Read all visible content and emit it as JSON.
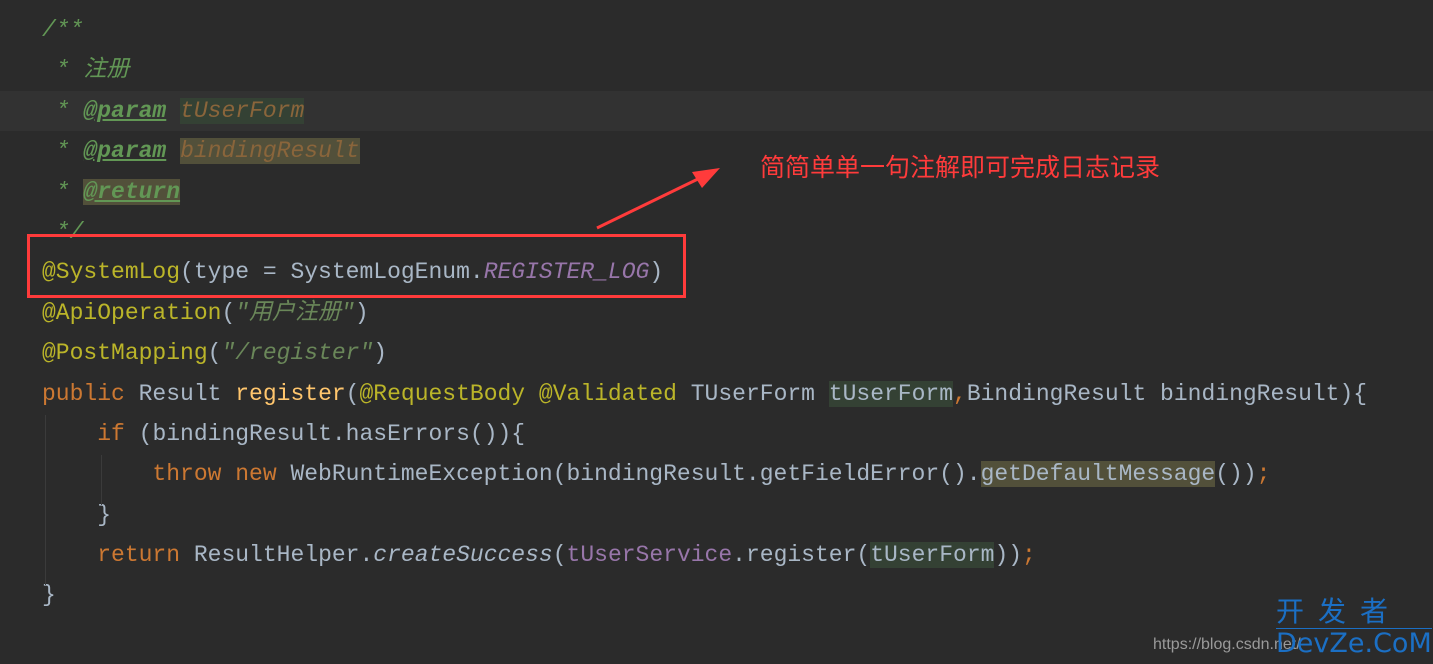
{
  "editor": {
    "current_line": 2,
    "lines": [
      [
        [
          "c",
          "/**"
        ]
      ],
      [
        [
          "c",
          " * 注册"
        ]
      ],
      [
        [
          "c",
          " * "
        ],
        [
          "ct",
          "@param"
        ],
        [
          "c",
          " "
        ],
        [
          "cp hl",
          "tUserForm"
        ]
      ],
      [
        [
          "c",
          " * "
        ],
        [
          "ct",
          "@param"
        ],
        [
          "c",
          " "
        ],
        [
          "cp hly",
          "bindingResult"
        ]
      ],
      [
        [
          "c",
          " * "
        ],
        [
          "ct hly",
          "@return"
        ]
      ],
      [
        [
          "c",
          " */"
        ]
      ],
      [
        [
          "a",
          "@SystemLog"
        ],
        [
          "t",
          "(type = SystemLogEnum."
        ],
        [
          "p",
          "REGISTER_LOG"
        ],
        [
          "t",
          ")"
        ]
      ],
      [
        [
          "a",
          "@ApiOperation"
        ],
        [
          "t",
          "("
        ],
        [
          "s",
          "\"用户注册\""
        ],
        [
          "t",
          ")"
        ]
      ],
      [
        [
          "a",
          "@PostMapping"
        ],
        [
          "t",
          "("
        ],
        [
          "s",
          "\"/register\""
        ],
        [
          "t",
          ")"
        ]
      ],
      [
        [
          "k",
          "public "
        ],
        [
          "t",
          "Result "
        ],
        [
          "m",
          "register"
        ],
        [
          "t",
          "("
        ],
        [
          "a",
          "@RequestBody @Validated "
        ],
        [
          "t",
          "TUserForm "
        ],
        [
          "t hl",
          "tUserForm"
        ],
        [
          "k",
          ","
        ],
        [
          "t",
          "BindingResult bindingResult){"
        ]
      ],
      [
        [
          "t",
          "    "
        ],
        [
          "k",
          "if "
        ],
        [
          "t",
          "(bindingResult.hasErrors()){"
        ]
      ],
      [
        [
          "t",
          "        "
        ],
        [
          "k",
          "throw new "
        ],
        [
          "t",
          "WebRuntimeException(bindingResult.getFieldError()."
        ],
        [
          "t hly",
          "getDefaultMessage"
        ],
        [
          "t",
          "())"
        ],
        [
          "k",
          ";"
        ]
      ],
      [
        [
          "t",
          "    }"
        ]
      ],
      [
        [
          "t",
          "    "
        ],
        [
          "k",
          "return "
        ],
        [
          "t",
          "ResultHelper."
        ],
        [
          "i",
          "createSuccess"
        ],
        [
          "t",
          "("
        ],
        [
          "f",
          "tUserService"
        ],
        [
          "t",
          ".register("
        ],
        [
          "t hl",
          "tUserForm"
        ],
        [
          "t",
          "))"
        ],
        [
          "k",
          ";"
        ]
      ],
      [
        [
          "t",
          "}"
        ]
      ]
    ]
  },
  "annotation": {
    "note": "简简单单一句注解即可完成日志记录",
    "color": "#ff3b3b"
  },
  "watermark": {
    "cn": "开发者",
    "en": "DevZe.CoM",
    "url": "https://blog.csdn.net/"
  }
}
